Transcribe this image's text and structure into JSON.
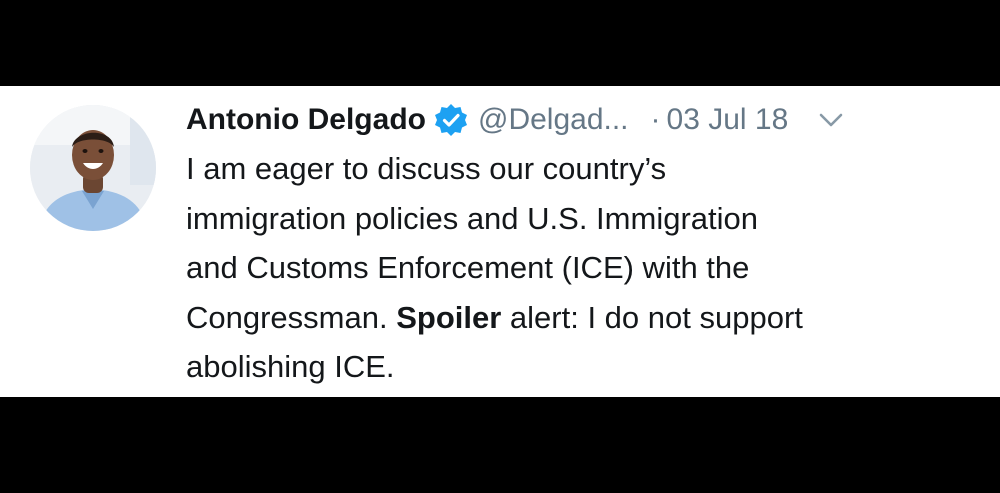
{
  "tweet": {
    "author_name": "Antonio Delgado",
    "handle": "@Delgad...",
    "separator": "·",
    "date": "03 Jul 18",
    "verified": true,
    "avatar_icon": "user-avatar",
    "menu_icon": "chevron-down-icon",
    "colors": {
      "verified_badge": "#1da1f2",
      "secondary_text": "#657786",
      "primary_text": "#14171a"
    },
    "text": {
      "line1": "I am eager to discuss our country’s",
      "line2": "immigration policies and U.S. Immigration",
      "line3": "and Customs Enforcement (ICE) with the",
      "line4_start": "Congressman. ",
      "line4_bold": "Spoiler",
      "line4_end": " alert: I do not support",
      "line5": "abolishing ICE."
    }
  }
}
